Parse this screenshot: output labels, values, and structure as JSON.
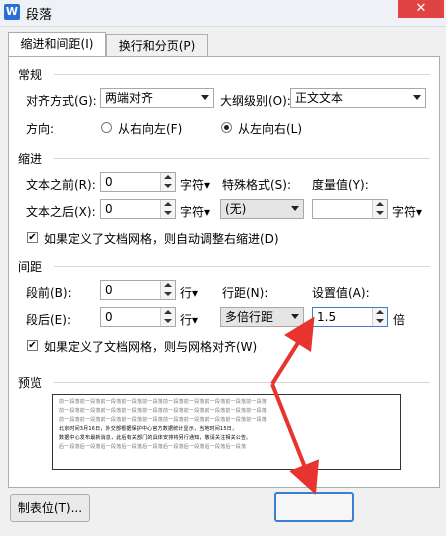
{
  "window": {
    "title": "段落",
    "app_icon_letter": "W",
    "close_glyph": "✕"
  },
  "tabs": [
    {
      "label": "缩进和间距(I)",
      "active": true
    },
    {
      "label": "换行和分页(P)",
      "active": false
    }
  ],
  "general": {
    "section": "常规",
    "alignment_label": "对齐方式(G):",
    "alignment_value": "两端对齐",
    "outline_label": "大纲级别(O):",
    "outline_value": "正文文本",
    "direction_label": "方向:",
    "rtl_label": "从右向左(F)",
    "ltr_label": "从左向右(L)",
    "direction_selected": "ltr"
  },
  "indent": {
    "section": "缩进",
    "before_label": "文本之前(R):",
    "before_value": "0",
    "after_label": "文本之后(X):",
    "after_value": "0",
    "unit": "字符▾",
    "special_label": "特殊格式(S):",
    "special_value": "(无)",
    "measure_label": "度量值(Y):",
    "measure_value": "",
    "measure_unit": "字符▾",
    "grid_check_label": "如果定义了文档网格，则自动调整右缩进(D)",
    "grid_checked": true
  },
  "spacing": {
    "section": "间距",
    "before_label": "段前(B):",
    "before_value": "0",
    "after_label": "段后(E):",
    "after_value": "0",
    "unit": "行▾",
    "line_label": "行距(N):",
    "line_value": "多倍行距",
    "setting_label": "设置值(A):",
    "setting_value": "1.5",
    "setting_unit": "倍",
    "grid_check_label": "如果定义了文档网格，则与网格对齐(W)",
    "grid_checked": true
  },
  "preview": {
    "section": "预览",
    "lines": [
      {
        "text": "前一段落前一段落前一段落前一段落前一段落前一段落前一段落前一段落前一段落前一段落",
        "dark": false
      },
      {
        "text": "前一段落前一段落前一段落前一段落前一段落前一段落前一段落前一段落前一段落前一段落",
        "dark": false
      },
      {
        "text": "前一段落前一段落前一段落前一段落前一段落前一段落前一段落前一段落前一段落前一段落",
        "dark": false
      },
      {
        "text": "北京时间3月16日，外交部根据保护中心官方数据统计显示，当地时间15日，",
        "dark": true
      },
      {
        "text": "数据中心发布最新消息，此后有关部门的具体安排将另行通知，敬请关注相关公告。",
        "dark": true
      },
      {
        "text": "后一段落后一段落后一段落后一段落后一段落后一段落后一段落后一段落后一段落",
        "dark": false
      }
    ]
  },
  "buttons": {
    "tabstop": "制表位(T)...",
    "ok": ""
  },
  "colors": {
    "annotation_arrow": "#e8342e",
    "accent": "#3c7fd1"
  }
}
